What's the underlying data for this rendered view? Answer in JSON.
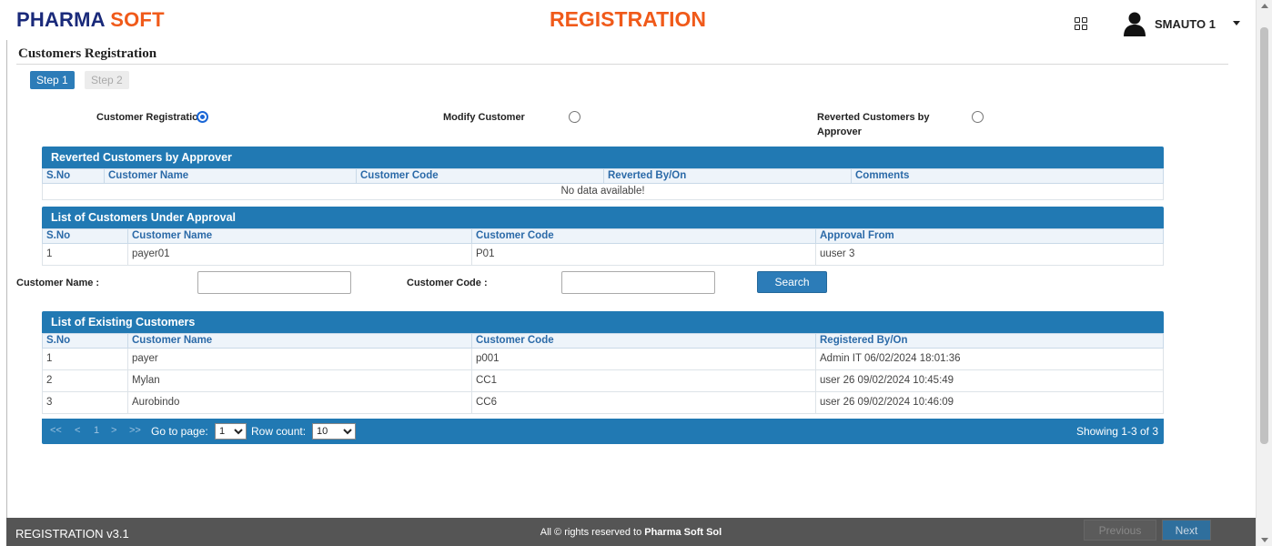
{
  "header": {
    "brand_part1": "PHARMA",
    "brand_part2": "SOFT",
    "page_heading": "REGISTRATION",
    "user_name": "SMAUTO 1"
  },
  "section": {
    "title": "Customers Registration",
    "steps": [
      "Step 1",
      "Step 2"
    ]
  },
  "options": {
    "customer_registration": "Customer Registration",
    "modify_customer": "Modify Customer",
    "reverted_by_approver_line1": "Reverted Customers by",
    "reverted_by_approver_line2": "Approver",
    "selected": "customer_registration"
  },
  "reverted_panel": {
    "title": "Reverted Customers by Approver",
    "columns": [
      "S.No",
      "Customer Name",
      "Customer Code",
      "Reverted By/On",
      "Comments"
    ],
    "empty_text": "No data available!"
  },
  "approval_panel": {
    "title": "List of Customers Under Approval",
    "columns": [
      "S.No",
      "Customer Name",
      "Customer Code",
      "Approval From"
    ],
    "rows": [
      [
        "1",
        "payer01",
        "P01",
        "uuser 3"
      ]
    ]
  },
  "search": {
    "name_label": "Customer Name :",
    "name_value": "",
    "code_label": "Customer Code :",
    "code_value": "",
    "button_label": "Search"
  },
  "existing_panel": {
    "title": "List of Existing Customers",
    "columns": [
      "S.No",
      "Customer Name",
      "Customer Code",
      "Registered By/On"
    ],
    "rows": [
      [
        "1",
        "payer",
        "p001",
        "Admin IT 06/02/2024 18:01:36"
      ],
      [
        "2",
        "Mylan",
        "CC1",
        "user 26 09/02/2024 10:45:49"
      ],
      [
        "3",
        "Aurobindo",
        "CC6",
        "user 26 09/02/2024 10:46:09"
      ]
    ]
  },
  "pager": {
    "first": "<<",
    "prev": "<",
    "page_number": "1",
    "next": ">",
    "last": ">>",
    "goto_label": "Go to page:",
    "goto_value": "1",
    "rowcount_label": "Row count:",
    "rowcount_value": "10",
    "showing": "Showing 1-3 of 3"
  },
  "footer": {
    "version": "REGISTRATION v3.1",
    "copyright_prefix": "All © rights reserved to ",
    "copyright_owner": "Pharma Soft Sol",
    "previous_label": "Previous",
    "next_label": "Next"
  },
  "colors": {
    "brand_navy": "#1a2a7a",
    "brand_orange": "#f05a1a",
    "panel_blue": "#2179b3",
    "footer_gray": "#555555"
  }
}
